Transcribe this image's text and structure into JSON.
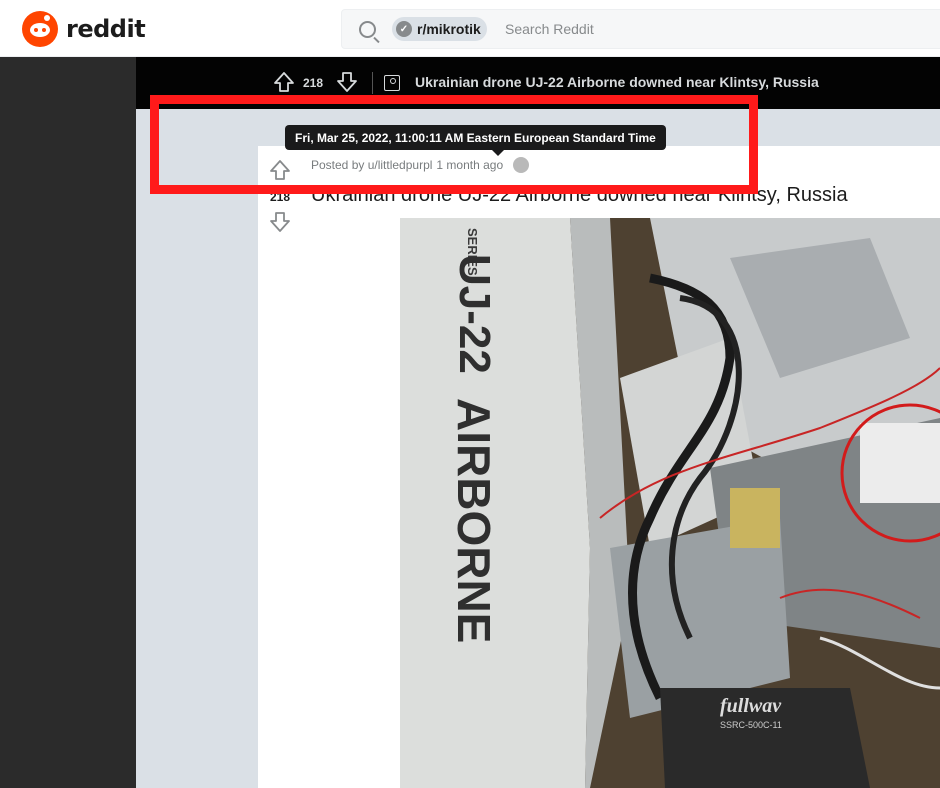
{
  "header": {
    "logo_text": "reddit",
    "search_chip": "r/mikrotik",
    "search_placeholder": "Search Reddit"
  },
  "post_bar": {
    "score": "218",
    "title": "Ukrainian drone UJ-22 Airborne downed near Klintsy, Russia"
  },
  "post": {
    "score": "218",
    "posted_by": "Posted by u/littledpurpl",
    "age": "1 month ago",
    "title": "Ukrainian drone UJ-22 Airborne downed near Klintsy, Russia",
    "image_text": {
      "series": "SERIES",
      "model": "UJ-22",
      "name": "AIRBORNE",
      "brand": "fullwav",
      "label": "SSRC-500C-11"
    }
  },
  "tooltip": "Fri, Mar 25, 2022, 11:00:11 AM Eastern European Standard Time",
  "colors": {
    "brand": "#ff4500",
    "highlight": "#ff1a1a",
    "topbar": "#030303"
  }
}
